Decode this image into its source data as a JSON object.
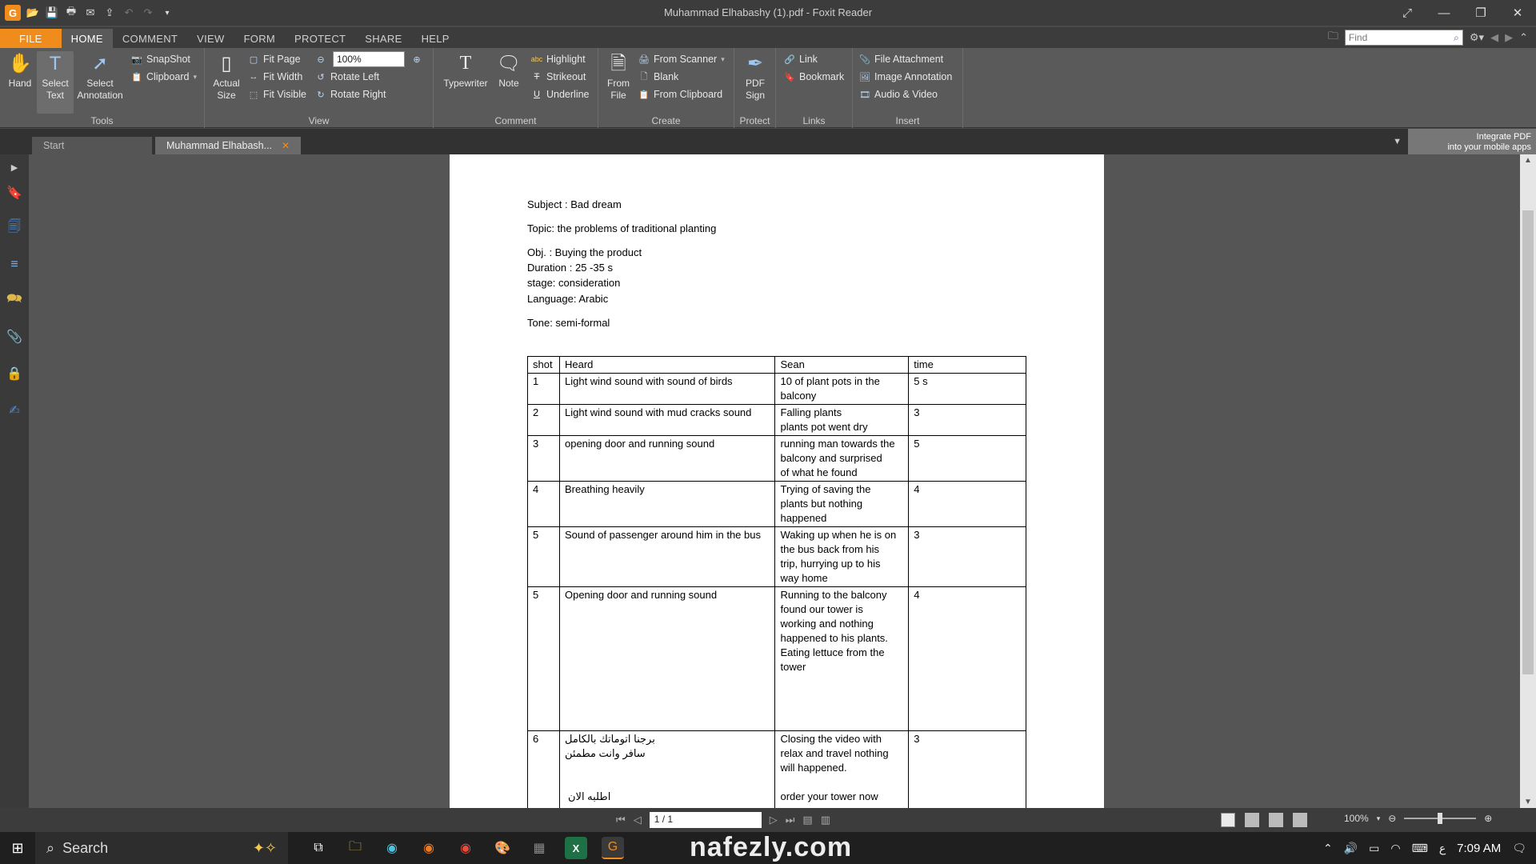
{
  "window": {
    "title": "Muhammad Elhabashy (1).pdf - Foxit Reader",
    "logo_letter": "G"
  },
  "menu": {
    "tabs": [
      "FILE",
      "HOME",
      "COMMENT",
      "VIEW",
      "FORM",
      "PROTECT",
      "SHARE",
      "HELP"
    ],
    "active": "HOME",
    "find_placeholder": "Find"
  },
  "ribbon": {
    "tools": {
      "label": "Tools",
      "hand": "Hand",
      "select_text": [
        "Select",
        "Text"
      ],
      "select_annotation": [
        "Select",
        "Annotation"
      ],
      "snapshot": "SnapShot",
      "clipboard": "Clipboard"
    },
    "view": {
      "label": "View",
      "actual_size": [
        "Actual",
        "Size"
      ],
      "fit_page": "Fit Page",
      "fit_width": "Fit Width",
      "fit_visible": "Fit Visible",
      "zoom": "100%",
      "rotate_left": "Rotate Left",
      "rotate_right": "Rotate Right"
    },
    "comment": {
      "label": "Comment",
      "typewriter": "Typewriter",
      "note": "Note",
      "highlight": "Highlight",
      "strikeout": "Strikeout",
      "underline": "Underline"
    },
    "create": {
      "label": "Create",
      "from_file": [
        "From",
        "File"
      ],
      "from_scanner": "From Scanner",
      "blank": "Blank",
      "from_clipboard": "From Clipboard"
    },
    "protect": {
      "label": "Protect",
      "pdf_sign": [
        "PDF",
        "Sign"
      ]
    },
    "links": {
      "label": "Links",
      "link": "Link",
      "bookmark": "Bookmark"
    },
    "insert": {
      "label": "Insert",
      "file_attachment": "File Attachment",
      "image_annotation": "Image Annotation",
      "audio_video": "Audio & Video"
    }
  },
  "doc_tabs": {
    "start": "Start",
    "current": "Muhammad Elhabash...",
    "promo": [
      "Integrate PDF",
      "into your mobile apps"
    ]
  },
  "document": {
    "subject": "Subject : Bad dream",
    "topic": "Topic: the problems of traditional planting",
    "obj": "Obj. : Buying the product",
    "duration": "Duration : 25 -35 s",
    "stage": "stage: consideration",
    "language": "Language: Arabic",
    "tone": "Tone: semi-formal",
    "table": {
      "headers": [
        "shot",
        "Heard",
        "Sean",
        "time"
      ],
      "rows": [
        {
          "shot": "1",
          "heard": [
            "Light wind sound with sound of birds"
          ],
          "sean": [
            "10 of plant pots in the",
            "balcony"
          ],
          "time": "5 s",
          "h": 37
        },
        {
          "shot": "2",
          "heard": [
            "Light wind sound with mud cracks sound"
          ],
          "sean": [
            "Falling plants",
            "plants pot went dry"
          ],
          "time": "3",
          "h": 37
        },
        {
          "shot": "3",
          "heard": [
            "opening door and running sound"
          ],
          "sean": [
            "running man towards the",
            "balcony   and surprised",
            "of what he found"
          ],
          "time": "5",
          "h": 54
        },
        {
          "shot": "4",
          "heard": [
            "Breathing heavily"
          ],
          "sean": [
            "Trying of saving the",
            "plants but nothing",
            "happened"
          ],
          "time": "4",
          "h": 54
        },
        {
          "shot": "5",
          "heard": [
            "Sound of passenger around him in the bus"
          ],
          "sean": [
            "Waking up when he is on",
            "the bus  back from his",
            "trip, hurrying up to his",
            "way home"
          ],
          "time": "3",
          "h": 72
        },
        {
          "shot": "5",
          "heard": [
            "Opening door and running sound"
          ],
          "sean": [
            "Running to the balcony",
            "found our tower is",
            "working and nothing",
            "happened to his plants.",
            "Eating lettuce from the",
            "tower"
          ],
          "time": "4",
          "h": 180
        },
        {
          "shot": "6",
          "heard": [
            "برجنا اتوماتك بالكامل",
            "سافر وانت مطمئن",
            "",
            "",
            "اطلبه الان"
          ],
          "sean": [
            "Closing the video with",
            "relax and travel nothing",
            "will happened.",
            "",
            "order your tower now"
          ],
          "time": "3",
          "h": 110
        }
      ]
    }
  },
  "status": {
    "page": "1 / 1",
    "zoom": "100%"
  },
  "watermark": {
    "text": "nafezly.com"
  },
  "taskbar": {
    "search": "Search",
    "lang": "ع",
    "time": "7:09 AM"
  }
}
